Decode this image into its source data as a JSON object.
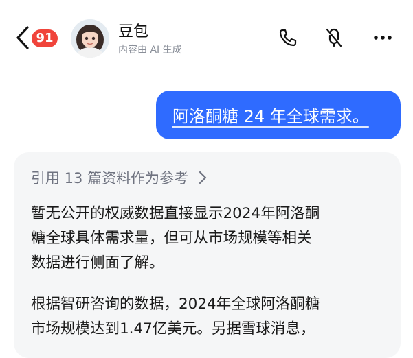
{
  "header": {
    "badge_count": "91",
    "contact_name": "豆包",
    "subtitle": "内容由 AI 生成",
    "icons": [
      "back-chevron-icon",
      "phone-icon",
      "mute-icon",
      "more-icon"
    ]
  },
  "messages": {
    "user": "阿洛酮糖 24 年全球需求。",
    "reply": {
      "references": "引用 13 篇资料作为参考",
      "lines_p1": [
        "暂无公开的权威数据直接显示2024年阿洛酮",
        "糖全球具体需求量，但可从市场规模等相关",
        "数据进行侧面了解。"
      ],
      "lines_p2": [
        "根据智研咨询的数据，2024年全球阿洛酮糖",
        "市场规模达到1.47亿美元。另据雪球消息，"
      ]
    }
  },
  "colors": {
    "accent": "#2f6bff",
    "badge": "#f0443b",
    "card_bg": "#f5f6f7",
    "muted_text": "#8a8f99"
  }
}
